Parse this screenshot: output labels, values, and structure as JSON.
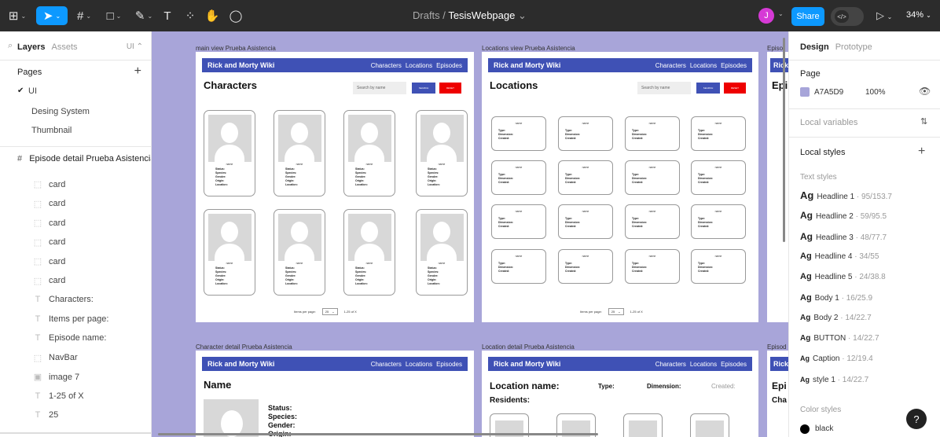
{
  "toolbar": {
    "file_path": "Drafts",
    "file_sep": "/",
    "file_name": "TesisWebpage",
    "avatar_initial": "J",
    "share_label": "Share",
    "code_label": "</>",
    "zoom_label": "34%"
  },
  "left_panel": {
    "tab_layers": "Layers",
    "tab_assets": "Assets",
    "page_badge": "UI",
    "pages_title": "Pages",
    "pages": [
      {
        "label": "UI",
        "selected": true
      },
      {
        "label": "Desing System",
        "selected": false
      },
      {
        "label": "Thumbnail",
        "selected": false
      }
    ],
    "frame_name": "Episode detail Prueba Asistencia",
    "layers": [
      {
        "label": "card",
        "icon": "frame-icon"
      },
      {
        "label": "card",
        "icon": "frame-icon"
      },
      {
        "label": "card",
        "icon": "frame-icon"
      },
      {
        "label": "card",
        "icon": "frame-icon"
      },
      {
        "label": "card",
        "icon": "frame-icon"
      },
      {
        "label": "card",
        "icon": "frame-icon"
      },
      {
        "label": "Characters:",
        "icon": "text-icon"
      },
      {
        "label": "Items per page:",
        "icon": "text-icon"
      },
      {
        "label": "Episode name:",
        "icon": "text-icon"
      },
      {
        "label": "NavBar",
        "icon": "frame-icon"
      },
      {
        "label": "image 7",
        "icon": "image-icon"
      },
      {
        "label": "1-25 of X",
        "icon": "text-icon"
      },
      {
        "label": "25",
        "icon": "text-icon"
      }
    ]
  },
  "canvas": {
    "bg_color": "#A7A5D9",
    "frames": {
      "main": {
        "label": "main view Prueba Asistencia",
        "brand": "Rick and Morty Wiki",
        "nav": [
          "Characters",
          "Locations",
          "Episodes"
        ],
        "heading": "Characters",
        "search_placeholder": "Search by name",
        "search_btn": "SEARCH",
        "reset_btn": "RESET",
        "card_name": "name",
        "card_fields": [
          "Status:",
          "Species:",
          "Gender:",
          "Origin:",
          "Location:"
        ],
        "pager_label": "Items per page:",
        "pager_value": "25",
        "pager_range": "1-25 of X"
      },
      "locations": {
        "label": "Locations view Prueba Asistencia",
        "brand": "Rick and Morty Wiki",
        "nav": [
          "Characters",
          "Locations",
          "Episodes"
        ],
        "heading": "Locations",
        "search_placeholder": "Search by name",
        "search_btn": "SEARCH",
        "reset_btn": "RESET",
        "card_name": "name",
        "card_fields": [
          "Type:",
          "Dimension:",
          "Created:"
        ],
        "pager_label": "Items per page:",
        "pager_value": "25",
        "pager_range": "1-25 of X"
      },
      "episodes": {
        "label": "Episo",
        "brand": "Rick",
        "heading": "Epi"
      },
      "char_detail": {
        "label": "Character detail Prueba Asistencia",
        "brand": "Rick and Morty Wiki",
        "nav": [
          "Characters",
          "Locations",
          "Episodes"
        ],
        "heading": "Name",
        "fields": [
          "Status:",
          "Species:",
          "Gender:",
          "Origin:"
        ]
      },
      "loc_detail": {
        "label": "Location detail Prueba Asistencia",
        "brand": "Rick and Morty Wiki",
        "nav": [
          "Characters",
          "Locations",
          "Episodes"
        ],
        "heading": "Location name:",
        "type_label": "Type:",
        "dimension_label": "Dimension:",
        "created_label": "Created:",
        "residents_label": "Residents:"
      },
      "ep_detail": {
        "label": "Episod",
        "brand": "Rick",
        "heading": "Epi",
        "sub": "Cha"
      }
    }
  },
  "right_panel": {
    "tab_design": "Design",
    "tab_prototype": "Prototype",
    "page_section": "Page",
    "page_color_hex": "A7A5D9",
    "page_opacity": "100%",
    "local_variables": "Local variables",
    "local_styles": "Local styles",
    "text_styles_title": "Text styles",
    "text_styles": [
      {
        "ag": "Ag",
        "name": "Headline 1",
        "meta": " · 95/153.7"
      },
      {
        "ag": "Ag",
        "name": "Headline 2",
        "meta": " · 59/95.5"
      },
      {
        "ag": "Ag",
        "name": "Headline 3",
        "meta": " · 48/77.7"
      },
      {
        "ag": "Ag",
        "name": "Headline 4",
        "meta": " · 34/55"
      },
      {
        "ag": "Ag",
        "name": "Headline 5",
        "meta": " · 24/38.8"
      },
      {
        "ag": "Ag",
        "name": "Body 1",
        "meta": " · 16/25.9"
      },
      {
        "ag": "Ag",
        "name": "Body 2",
        "meta": " · 14/22.7"
      },
      {
        "ag": "Ag",
        "name": "BUTTON",
        "meta": " · 14/22.7"
      },
      {
        "ag": "Ag",
        "name": "Caption",
        "meta": " · 12/19.4"
      },
      {
        "ag": "Ag",
        "name": "style 1",
        "meta": " · 14/22.7"
      }
    ],
    "color_styles_title": "Color styles",
    "color_styles": [
      {
        "name": "black",
        "hex": "#000000"
      }
    ],
    "help": "?"
  }
}
